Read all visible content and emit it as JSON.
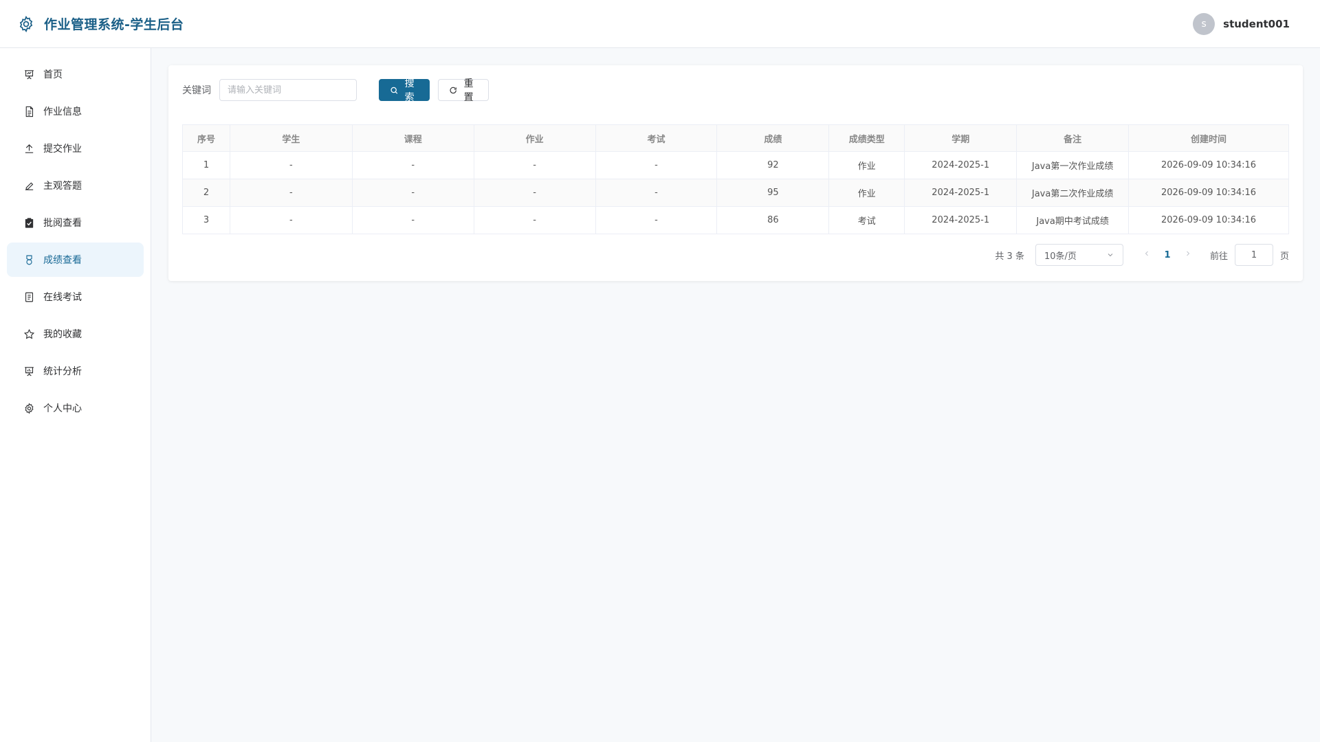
{
  "header": {
    "title": "作业管理系统-学生后台",
    "avatar_letter": "s",
    "username": "student001"
  },
  "sidebar": {
    "items": [
      {
        "label": "首页",
        "icon": "presentation-icon"
      },
      {
        "label": "作业信息",
        "icon": "document-icon"
      },
      {
        "label": "提交作业",
        "icon": "upload-icon"
      },
      {
        "label": "主观答题",
        "icon": "edit-pen-icon"
      },
      {
        "label": "批阅查看",
        "icon": "clipboard-check-icon"
      },
      {
        "label": "成绩查看",
        "icon": "medal-icon",
        "active": true
      },
      {
        "label": "在线考试",
        "icon": "tickets-icon"
      },
      {
        "label": "我的收藏",
        "icon": "star-icon"
      },
      {
        "label": "统计分析",
        "icon": "data-board-icon"
      },
      {
        "label": "个人中心",
        "icon": "gear-icon"
      }
    ]
  },
  "search": {
    "label": "关键词",
    "placeholder": "请输入关键词",
    "search_label": "搜索",
    "reset_label": "重置"
  },
  "table": {
    "columns": [
      "序号",
      "学生",
      "课程",
      "作业",
      "考试",
      "成绩",
      "成绩类型",
      "学期",
      "备注",
      "创建时间"
    ],
    "rows": [
      [
        "1",
        "-",
        "-",
        "-",
        "-",
        "92",
        "作业",
        "2024-2025-1",
        "Java第一次作业成绩",
        "2026-09-09 10:34:16"
      ],
      [
        "2",
        "-",
        "-",
        "-",
        "-",
        "95",
        "作业",
        "2024-2025-1",
        "Java第二次作业成绩",
        "2026-09-09 10:34:16"
      ],
      [
        "3",
        "-",
        "-",
        "-",
        "-",
        "86",
        "考试",
        "2024-2025-1",
        "Java期中考试成绩",
        "2026-09-09 10:34:16"
      ]
    ]
  },
  "pagination": {
    "total_text": "共 3 条",
    "page_size": "10条/页",
    "current_page": "1",
    "goto_label": "前往",
    "goto_value": "1",
    "page_suffix": "页"
  },
  "colors": {
    "primary": "#176a95",
    "brand_text": "#1a5f87",
    "active_bg": "#ecf5fc"
  }
}
